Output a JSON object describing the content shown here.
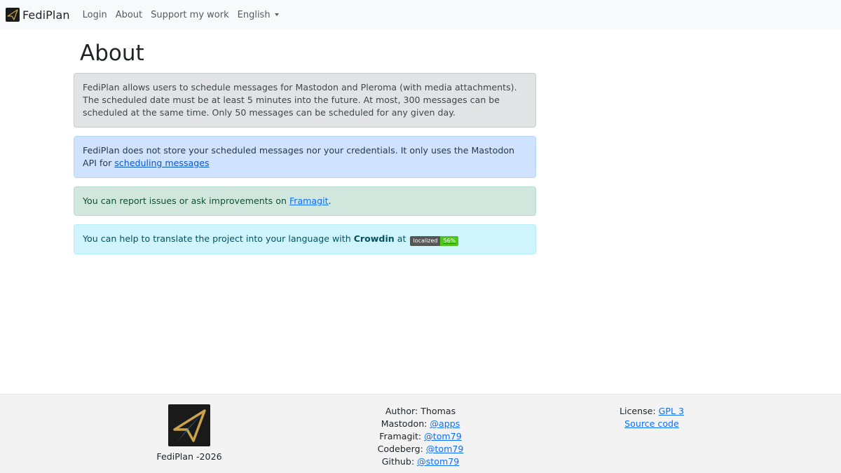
{
  "navbar": {
    "brand": "FediPlan",
    "links": {
      "login": "Login",
      "about": "About",
      "support": "Support my work",
      "language": "English"
    }
  },
  "page": {
    "title": "About"
  },
  "alerts": {
    "info_general": {
      "line1": "FediPlan allows users to schedule messages for Mastodon and Pleroma (with media attachments).",
      "line2": "The scheduled date must be at least 5 minutes into the future. At most, 300 messages can be scheduled at the same time. Only 50 messages can be scheduled for any given day."
    },
    "privacy": {
      "text": "FediPlan does not store your scheduled messages nor your credentials. It only uses the Mastodon API for ",
      "link": "scheduling messages"
    },
    "issues": {
      "text": "You can report issues or ask improvements on ",
      "link": "Framagit",
      "end": "."
    },
    "translate": {
      "text": "You can help to translate the project into your language with ",
      "strong": "Crowdin",
      "at": " at",
      "badge_label": "localized",
      "badge_value": "56%"
    }
  },
  "footer": {
    "left": {
      "copyright": "FediPlan -2026"
    },
    "middle": {
      "author": "Author: Thomas",
      "mastodon_label": "Mastodon: ",
      "mastodon_link": "@apps",
      "framagit_label": "Framagit: ",
      "framagit_link": "@tom79",
      "codeberg_label": "Codeberg: ",
      "codeberg_link": "@tom79",
      "github_label": "Github: ",
      "github_link": "@stom79"
    },
    "right": {
      "license_label": "License: ",
      "license_link": "GPL 3",
      "source_link": "Source code"
    }
  },
  "colors": {
    "navbar_bg": "#f8f9fa",
    "link": "#0d6efd",
    "logo_bg": "#1a1a1a",
    "logo_gold": "#c9a24b",
    "logo_blue": "#1e8fe0"
  },
  "icons": {
    "brand_logo": "paper-plane-logo",
    "language_dropdown": "caret-down-icon"
  }
}
